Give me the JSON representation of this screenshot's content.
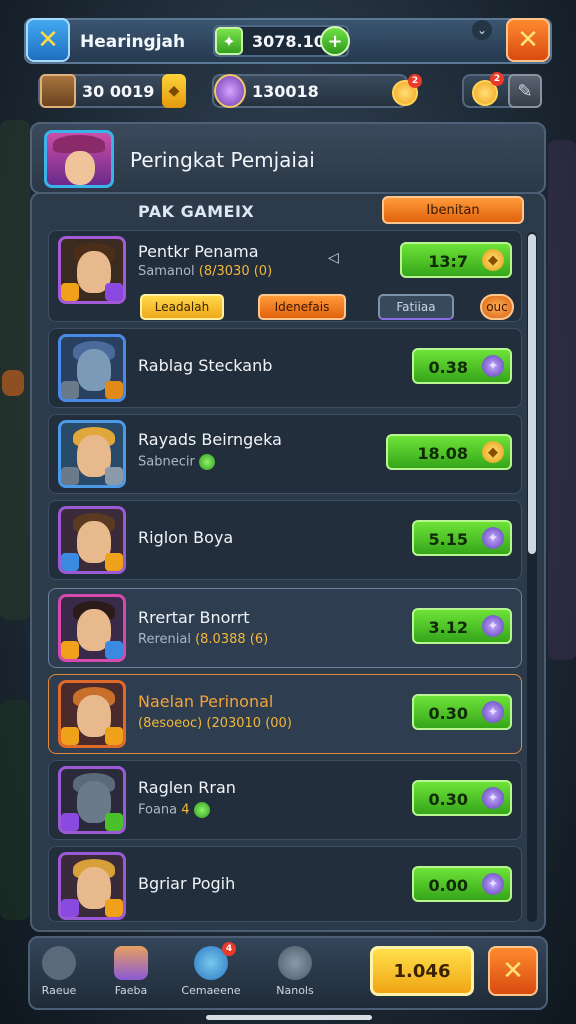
{
  "top_bar": {
    "player_name": "Hearingjah",
    "currency_value": "3078.10",
    "plus_symbol": "+",
    "close_symbol": "✕",
    "chevron": "⌄"
  },
  "resources": {
    "gold_value": "30 0019",
    "shield_value": "130018",
    "notif_count": "2"
  },
  "header": {
    "title": "Peringkat Pemjaiai"
  },
  "board": {
    "heading": "PAK GAMEIX",
    "orange_button": "Ibenitan",
    "tabs": [
      "Leadalah",
      "Idenefais",
      "Fatiiaa",
      "ouc"
    ]
  },
  "rows": [
    {
      "name": "Pentkr Penama",
      "sub_prefix": "Samanol",
      "sub_gold": "(8/3030 (0)",
      "score": "13:7",
      "icon": "coin",
      "highlight": false
    },
    {
      "name": "Rablag Steckanb",
      "sub_prefix": "",
      "sub_gold": "",
      "score": "0.38",
      "icon": "gem",
      "highlight": false
    },
    {
      "name": "Rayads Beirngeka",
      "sub_prefix": "Sabnecir",
      "sub_gold": "",
      "score": "18.08",
      "icon": "coin",
      "highlight": false,
      "smile": true
    },
    {
      "name": "Riglon Boya",
      "sub_prefix": "",
      "sub_gold": "",
      "score": "5.15",
      "icon": "gem",
      "highlight": false
    },
    {
      "name": "Rrertar Bnorrt",
      "sub_prefix": "Rerenial",
      "sub_gold": "(8.0388 (6)",
      "score": "3.12",
      "icon": "gem",
      "highlight": true
    },
    {
      "name": "Naelan Perinonal",
      "sub_prefix": "",
      "sub_gold": "(8esoeoc) (203010 (00)",
      "score": "0.30",
      "icon": "gem",
      "highlight": true,
      "orange": true
    },
    {
      "name": "Raglen Rran",
      "sub_prefix": "Foana",
      "sub_gold": "4",
      "score": "0.30",
      "icon": "gem",
      "highlight": false,
      "smile": true
    },
    {
      "name": "Bgriar Pogih",
      "sub_prefix": "",
      "sub_gold": "",
      "score": "0.00",
      "icon": "gem",
      "highlight": false
    }
  ],
  "bottom_nav": {
    "items": [
      "Raeue",
      "Faeba",
      "Cemaeene",
      "Nanols"
    ],
    "coin_value": "1.046",
    "badge": "4"
  },
  "colors": {
    "accent_green": "#4cc92a",
    "accent_orange": "#ef7b1e",
    "accent_yellow": "#f8c630",
    "panel": "#2d3a4a"
  }
}
